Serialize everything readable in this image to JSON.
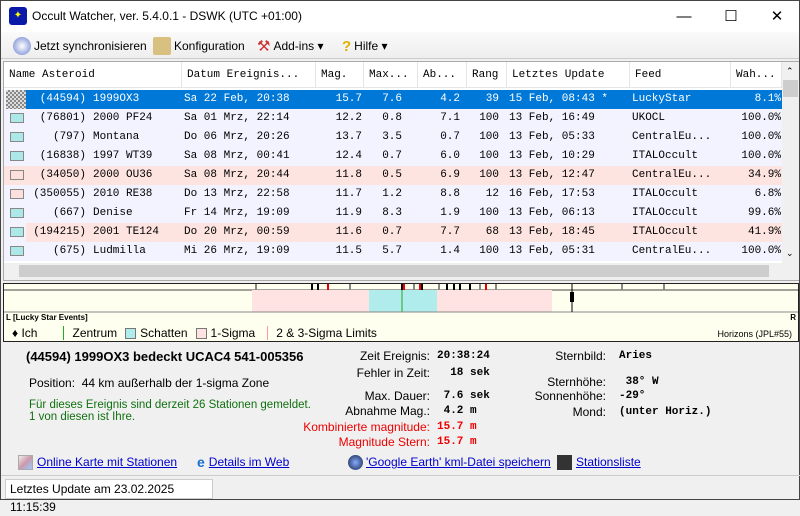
{
  "window": {
    "title": "Occult Watcher, ver. 5.4.0.1 - DSWK (UTC +01:00)",
    "minimize": "—",
    "maximize": "☐",
    "close": "✕"
  },
  "toolbar": {
    "sync": "Jetzt synchronisieren",
    "config": "Konfiguration",
    "addins": "Add-ins ▾",
    "help": "Hilfe ▾"
  },
  "table": {
    "columns": [
      "Name Asteroid",
      "Datum Ereignis...",
      "Mag.",
      "Max...",
      "Ab...",
      "Rang",
      "Letztes Update",
      "Feed",
      "Wah..."
    ],
    "rows": [
      {
        "num": "(44594)",
        "name": "1999OX3",
        "date": "Sa 22 Feb, 20:38",
        "mag": "15.7",
        "max": "7.6",
        "ab": "4.2",
        "rang": "39",
        "update": "15 Feb, 08:43 *",
        "feed": "LuckyStar",
        "wah": "8.1%",
        "status": "selected"
      },
      {
        "num": "(76801)",
        "name": "2000 PF24",
        "date": "Sa 01 Mrz, 22:14",
        "mag": "12.2",
        "max": "0.8",
        "ab": "7.1",
        "rang": "100",
        "update": "13 Feb, 16:49",
        "feed": "UKOCL",
        "wah": "100.0%",
        "status": "cyan"
      },
      {
        "num": "(797)",
        "name": "Montana",
        "date": "Do 06 Mrz, 20:26",
        "mag": "13.7",
        "max": "3.5",
        "ab": "0.7",
        "rang": "100",
        "update": "13 Feb, 05:33",
        "feed": "CentralEu...",
        "wah": "100.0%",
        "status": "cyan"
      },
      {
        "num": "(16838)",
        "name": "1997 WT39",
        "date": "Sa 08 Mrz, 00:41",
        "mag": "12.4",
        "max": "0.7",
        "ab": "6.0",
        "rang": "100",
        "update": "13 Feb, 10:29",
        "feed": "ITALOccult",
        "wah": "100.0%",
        "status": "cyan"
      },
      {
        "num": "(34050)",
        "name": "2000 OU36",
        "date": "Sa 08 Mrz, 20:44",
        "mag": "11.8",
        "max": "0.5",
        "ab": "6.9",
        "rang": "100",
        "update": "13 Feb, 12:47",
        "feed": "CentralEu...",
        "wah": "34.9%",
        "status": "pink"
      },
      {
        "num": "(350055)",
        "name": "2010 RE38",
        "date": "Do 13 Mrz, 22:58",
        "mag": "11.7",
        "max": "1.2",
        "ab": "8.8",
        "rang": "12",
        "update": "16 Feb, 17:53",
        "feed": "ITALOccult",
        "wah": "6.8%",
        "status": "pink-normal"
      },
      {
        "num": "(667)",
        "name": "Denise",
        "date": "Fr 14 Mrz, 19:09",
        "mag": "11.9",
        "max": "8.3",
        "ab": "1.9",
        "rang": "100",
        "update": "13 Feb, 06:13",
        "feed": "ITALOccult",
        "wah": "99.6%",
        "status": "cyan"
      },
      {
        "num": "(194215)",
        "name": "2001 TE124",
        "date": "Do 20 Mrz, 00:59",
        "mag": "11.6",
        "max": "0.7",
        "ab": "7.7",
        "rang": "68",
        "update": "13 Feb, 18:45",
        "feed": "ITALOccult",
        "wah": "41.9%",
        "status": "cyan-pinkrow"
      },
      {
        "num": "(675)",
        "name": "Ludmilla",
        "date": "Mi 26 Mrz, 19:09",
        "mag": "11.5",
        "max": "5.7",
        "ab": "1.4",
        "rang": "100",
        "update": "13 Feb, 05:31",
        "feed": "CentralEu...",
        "wah": "100.0%",
        "status": "cyan"
      }
    ]
  },
  "chart": {
    "left": "L",
    "right": "R",
    "source": "[Lucky Star Events]",
    "legend": {
      "me": "Ich",
      "center": "Zentrum",
      "shadow": "Schatten",
      "sigma1": "1-Sigma",
      "sigma23": "2 & 3-Sigma Limits"
    },
    "horizons": "Horizons (JPL#55)",
    "colors": {
      "shadow": "#b0ecec",
      "sigma": "#ffe2e2",
      "center": "#22aa22"
    }
  },
  "details": {
    "title": "(44594) 1999OX3 bedeckt UCAC4 541-005356",
    "position_label": "Position:",
    "position": "44 km außerhalb der 1-sigma Zone",
    "stations1": "Für dieses Ereignis sind derzeit 26 Stationen gemeldet.",
    "stations2": "1 von diesen ist Ihre.",
    "fields": [
      {
        "label": "Zeit Ereignis:",
        "value": "20:38:24"
      },
      {
        "label": "Fehler in Zeit:",
        "value": "  18 sek"
      },
      {
        "label": "Max. Dauer:",
        "value": " 7.6 sek"
      },
      {
        "label": "Abnahme Mag.:",
        "value": " 4.2 m"
      },
      {
        "label": "Kombinierte magnitude:",
        "value": "15.7 m"
      },
      {
        "label": "Magnitude Stern:",
        "value": "15.7 m"
      }
    ],
    "right": [
      {
        "label": "Sternbild:",
        "value": "Aries"
      },
      {
        "label": "Sternhöhe:",
        "value": " 38° W"
      },
      {
        "label": "Sonnenhöhe:",
        "value": "-29°"
      },
      {
        "label": "Mond:",
        "value": "(unter Horiz.)"
      }
    ],
    "links": [
      "Online Karte mit Stationen",
      "Details im Web",
      "'Google Earth' kml-Datei speichern",
      "Stationsliste"
    ]
  },
  "status": "Letztes Update am 23.02.2025 11:15:39"
}
